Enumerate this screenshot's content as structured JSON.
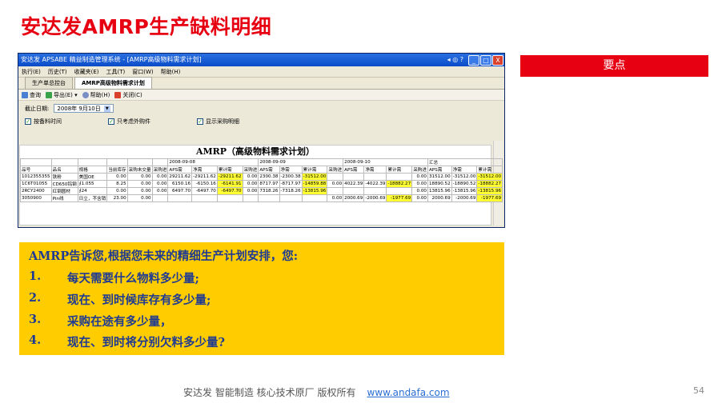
{
  "slide": {
    "title": "安达发AMRP生产缺料明细",
    "key_points_label": "要点",
    "footer_text": "安达发  智能制造 核心技术原厂   版权所有",
    "footer_link": "www.andafa.com",
    "page_number": "54"
  },
  "window": {
    "title": "安达发  APSABE  精益制造管理系统 - [AMRP高级物料需求计划]",
    "title_extra": "◂ ◎ ?",
    "controls": [
      "_",
      "□",
      "X"
    ],
    "menu": [
      "执行(E)",
      "历史(T)",
      "收藏夹(E)",
      "工具(T)",
      "窗口(W)",
      "帮助(H)"
    ],
    "tabs": [
      "生产单总控台",
      "AMRP高级物料需求计划"
    ],
    "toolbar": [
      "查询",
      "导出(E) ▾",
      "帮助(H)",
      "关闭(C)"
    ],
    "filters": {
      "date_label": "截止日期:",
      "date_value": "2008年 9月10日",
      "checkboxes": [
        "按备料时间",
        "只考虑外购件",
        "显示采购明细"
      ]
    }
  },
  "report": {
    "title": "AMRP（高级物料需求计划）",
    "group_headers": [
      "2008-09-08",
      "2008-09-09",
      "2008-09-10",
      "汇总"
    ],
    "fixed_headers": [
      "品号",
      "品名",
      "规格",
      "当前库存",
      "采购未交量",
      "采购进"
    ],
    "group_columns": [
      "采购进",
      "APS需",
      "净需",
      "累计需"
    ],
    "rows": [
      {
        "code": "1012355355",
        "name": "铁粉",
        "spec": "美国OE",
        "stock": "0.00",
        "open_po": "0.00",
        "cells": [
          "0.00",
          "29211.62",
          "-29211.62",
          "-29211.62",
          "0.00",
          "2300.38",
          "-2300.38",
          "-31512.00",
          "",
          "",
          "",
          "",
          "0.00",
          "31512.00",
          "-31512.00",
          "-31512.00"
        ],
        "hl": [
          3,
          7,
          15
        ]
      },
      {
        "code": "1C6T01055",
        "name": "CD650钨钢",
        "spec": "∮1.055",
        "stock": "8.25",
        "open_po": "0.00",
        "cells": [
          "0.00",
          "6150.16",
          "-6150.16",
          "-6141.91",
          "0.00",
          "8717.97",
          "-8717.97",
          "-14859.88",
          "0.00",
          "4022.39",
          "-4022.39",
          "-18882.27",
          "0.00",
          "18890.52",
          "-18890.52",
          "-18882.27"
        ],
        "hl": [
          3,
          7,
          11,
          15
        ]
      },
      {
        "code": "2RCY2400",
        "name": "红钢圆材",
        "spec": "∮24",
        "stock": "0.00",
        "open_po": "0.00",
        "cells": [
          "0.00",
          "6497.70",
          "-6497.70",
          "-6497.70",
          "0.00",
          "7318.26",
          "-7318.26",
          "-13815.96",
          "",
          "",
          "",
          "",
          "0.00",
          "13815.96",
          "-13815.96",
          "-13815.96"
        ],
        "hl": [
          3,
          7,
          15
        ]
      },
      {
        "code": "3050900",
        "name": "Pin线",
        "spec": "日立，不含销",
        "stock": "23.00",
        "open_po": "0.00",
        "cells": [
          "",
          "",
          "",
          "",
          "",
          "",
          "",
          "",
          "0.00",
          "2000.69",
          "-2000.69",
          "-1977.69",
          "0.00",
          "2000.69",
          "-2000.69",
          "-1977.69"
        ],
        "hl": [
          11,
          15
        ]
      }
    ]
  },
  "highlight_box": {
    "lead": "AMRP告诉您,根据您未来的精细生产计划安排，您:",
    "items": [
      {
        "n": "1.",
        "text": "每天需要什么物料多少量;"
      },
      {
        "n": "2.",
        "text": "现在、到时候库存有多少量;"
      },
      {
        "n": "3.",
        "text": "采购在途有多少量，"
      },
      {
        "n": "4.",
        "text": "现在、到时将分别欠料多少量?"
      }
    ]
  },
  "colors": {
    "accent_red": "#e60012",
    "box_yellow": "#ffcc00",
    "text_blue": "#1f3a93",
    "cell_highlight": "#ffff33"
  }
}
